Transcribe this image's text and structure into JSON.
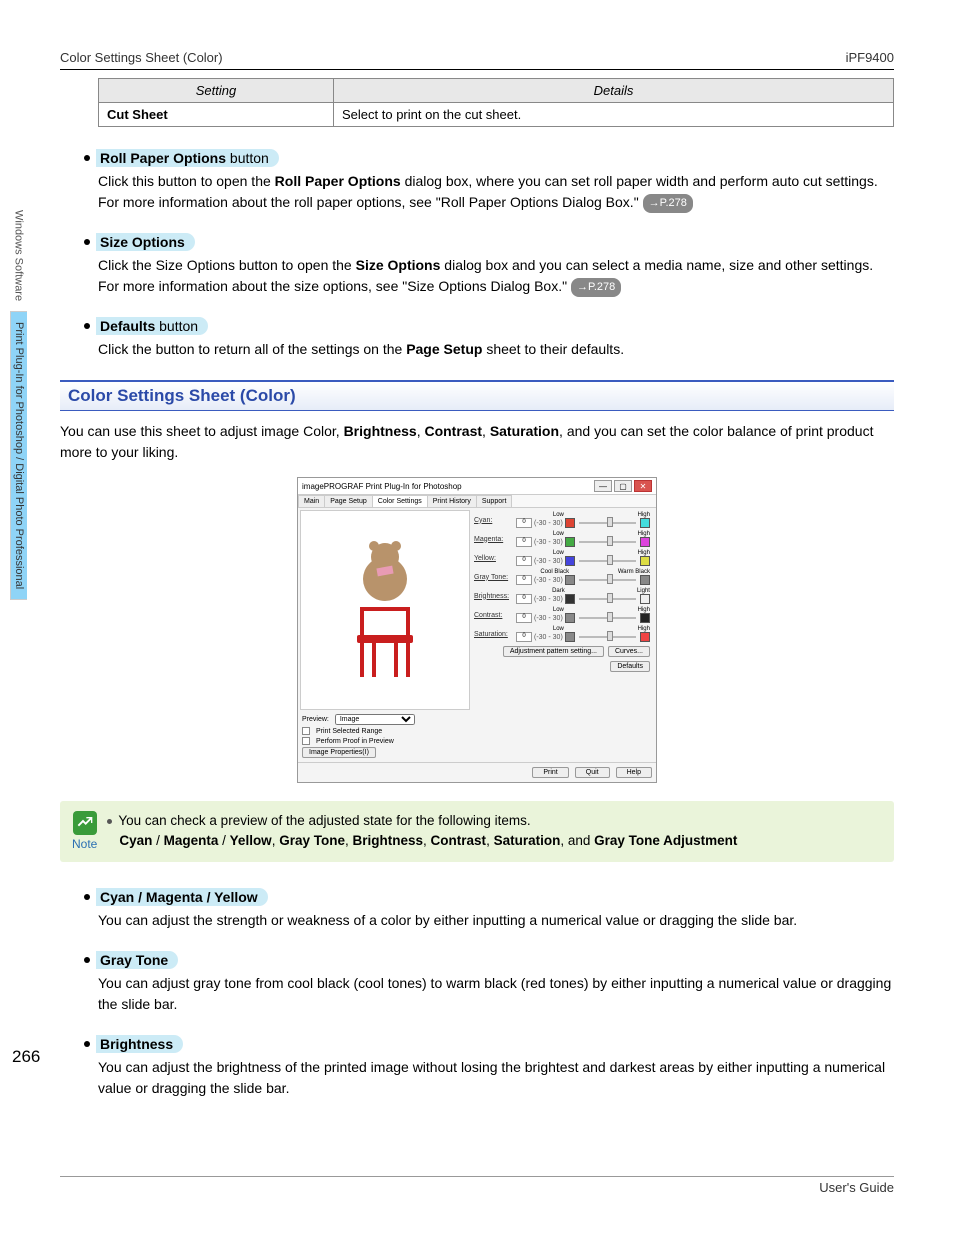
{
  "header": {
    "left": "Color Settings Sheet (Color)",
    "right": "iPF9400"
  },
  "table": {
    "h1": "Setting",
    "h2": "Details",
    "r1c1": "Cut Sheet",
    "r1c2": "Select to print on the cut sheet."
  },
  "s1": {
    "title_bold": "Roll Paper Options",
    "title_rest": " button",
    "p1a": "Click this button to open the ",
    "p1b": "Roll Paper Options",
    "p1c": " dialog box, where you can set roll paper width and perform auto cut settings.",
    "p2": "For more information about the roll paper options, see \"Roll Paper Options Dialog Box.\" ",
    "ref": "→P.278"
  },
  "s2": {
    "title_bold": "Size Options",
    "p1a": "Click the Size Options button to open the ",
    "p1b": "Size Options",
    "p1c": " dialog box and you can select a media name, size and other settings.",
    "p2": "For more information about the size options, see \"Size Options Dialog Box.\" ",
    "ref": "→P.278"
  },
  "s3": {
    "title_bold": "Defaults",
    "title_rest": " button",
    "p1a": "Click the button to return all of the settings on the ",
    "p1b": "Page Setup",
    "p1c": " sheet to their defaults."
  },
  "section_title": "Color Settings Sheet (Color)",
  "intro": {
    "a": "You can use this sheet to adjust image Color, ",
    "b": "Brightness",
    "c": ", ",
    "d": "Contrast",
    "e": ", ",
    "f": "Saturation",
    "g": ", and you can set the color balance of print product more to your liking."
  },
  "dialog": {
    "title": "imagePROGRAF Print Plug-In for Photoshop",
    "tabs": [
      "Main",
      "Page Setup",
      "Color Settings",
      "Print History",
      "Support"
    ],
    "sliders": [
      {
        "label": "Cyan:",
        "low": "Low",
        "high": "High",
        "val": "0",
        "range": "(-30 - 30)",
        "cl": "#d43",
        "cr": "#4dd"
      },
      {
        "label": "Magenta:",
        "low": "Low",
        "high": "High",
        "val": "0",
        "range": "(-30 - 30)",
        "cl": "#4a4",
        "cr": "#d4d"
      },
      {
        "label": "Yellow:",
        "low": "Low",
        "high": "High",
        "val": "0",
        "range": "(-30 - 30)",
        "cl": "#44d",
        "cr": "#dd4"
      },
      {
        "label": "Gray Tone:",
        "low": "Cool Black",
        "high": "Warm Black",
        "val": "0",
        "range": "(-30 - 30)",
        "cl": "#888",
        "cr": "#888"
      },
      {
        "label": "Brightness:",
        "low": "Dark",
        "high": "Light",
        "val": "0",
        "range": "(-30 - 30)",
        "cl": "#333",
        "cr": "#eee"
      },
      {
        "label": "Contrast:",
        "low": "Low",
        "high": "High",
        "val": "0",
        "range": "(-30 - 30)",
        "cl": "#888",
        "cr": "#222"
      },
      {
        "label": "Saturation:",
        "low": "Low",
        "high": "High",
        "val": "0",
        "range": "(-30 - 30)",
        "cl": "#888",
        "cr": "#e44"
      }
    ],
    "btn_adj": "Adjustment pattern setting...",
    "btn_curves": "Curves...",
    "btn_defaults": "Defaults",
    "preview_label": "Preview:",
    "preview_value": "Image",
    "cb1": "Print Selected Range",
    "cb2": "Perform Proof in Preview",
    "btn_imgprop": "Image Properties(I)",
    "btn_print": "Print",
    "btn_quit": "Quit",
    "btn_help": "Help"
  },
  "note": {
    "label": "Note",
    "line1": "You can check a preview of the adjusted state for the following items.",
    "l2a": "Cyan",
    "sep": " / ",
    "l2b": "Magenta",
    "l2c": "Yellow",
    "comma": ", ",
    "l2d": "Gray Tone",
    "l2e": "Brightness",
    "l2f": "Contrast",
    "l2g": "Saturation",
    "and": ", and ",
    "l2h": "Gray Tone Adjustment"
  },
  "s4": {
    "title": "Cyan / Magenta / Yellow",
    "body": "You can adjust the strength or weakness of a color by either inputting a numerical value or dragging the slide bar."
  },
  "s5": {
    "title": "Gray Tone",
    "body": "You can adjust gray tone from cool black (cool tones) to warm black (red tones) by either inputting a numerical value or dragging the slide bar."
  },
  "s6": {
    "title": "Brightness",
    "body": "You can adjust the brightness of the printed image without losing the brightest and darkest areas by either inputting a numerical value or dragging the slide bar."
  },
  "side": {
    "tab1": "Windows Software",
    "tab2": "Print Plug-In for Photoshop / Digital Photo Professional"
  },
  "page_num": "266",
  "footer": "User's Guide"
}
